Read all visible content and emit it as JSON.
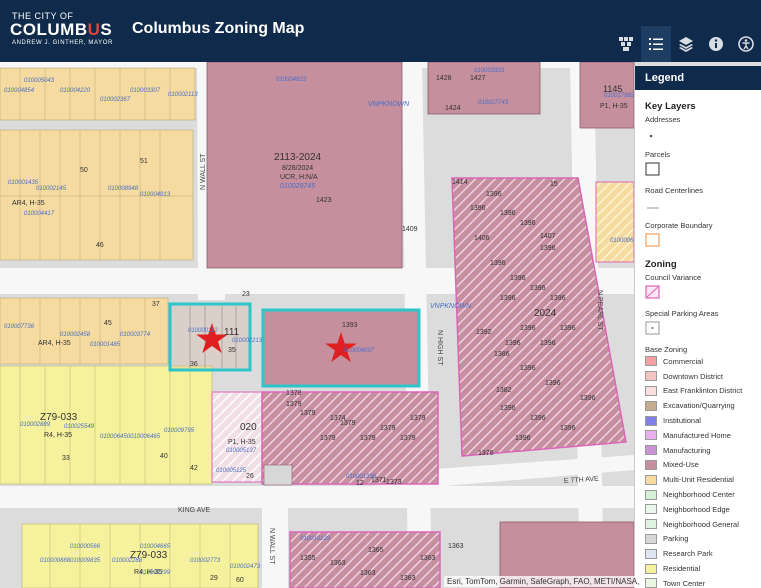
{
  "header": {
    "logo_top": "THE CITY OF",
    "logo_main_a": "COLUMB",
    "logo_main_b": "U",
    "logo_main_c": "S",
    "logo_sub": "ANDREW J. GINTHER, MAYOR",
    "title": "Columbus Zoning Map",
    "toolbar_icons": [
      "basemap-gallery-icon",
      "legend-list-icon",
      "layers-icon",
      "info-icon",
      "accessibility-icon"
    ]
  },
  "colors": {
    "header_bg": "#0f2a4a",
    "mixed_use": "#c58f9e",
    "multi_unit": "#f5dba0",
    "residential": "#f6f19c",
    "council_variance": "#d966b8",
    "selection": "#2cc6c8",
    "star": "#e02020"
  },
  "legend": {
    "title": "Legend",
    "key_layers": "Key Layers",
    "addresses": "Addresses",
    "parcels": "Parcels",
    "road_centerlines": "Road Centerlines",
    "corporate_boundary": "Corporate Boundary",
    "zoning": "Zoning",
    "council_variance": "Council Variance",
    "special_parking": "Special Parking Areas",
    "base_zoning": "Base Zoning",
    "zones": [
      {
        "label": "Commercial",
        "color": "#f3a1a1"
      },
      {
        "label": "Downtown District",
        "color": "#f6c3c3"
      },
      {
        "label": "East Franklinton District",
        "color": "#f9dede"
      },
      {
        "label": "Excavation/Quarrying",
        "color": "#c4ad8f"
      },
      {
        "label": "Institutional",
        "color": "#8080e8"
      },
      {
        "label": "Manufactured Home",
        "color": "#eab0ee"
      },
      {
        "label": "Manufacturing",
        "color": "#c993d6"
      },
      {
        "label": "Mixed-Use",
        "color": "#c58f9e"
      },
      {
        "label": "Multi-Unit Residential",
        "color": "#f5dba0"
      },
      {
        "label": "Neighborhood Center",
        "color": "#d6f0d6"
      },
      {
        "label": "Neighborhood Edge",
        "color": "#eaf6ea"
      },
      {
        "label": "Neighborhood General",
        "color": "#e1f3e1"
      },
      {
        "label": "Parking",
        "color": "#d7d7d7"
      },
      {
        "label": "Research Park",
        "color": "#dfe6ef"
      },
      {
        "label": "Residential",
        "color": "#f6f19c"
      },
      {
        "label": "Town Center",
        "color": "#e9f7e4"
      }
    ]
  },
  "map": {
    "streets": {
      "n_wall_top": "N WALL ST",
      "n_high": "N HIGH ST",
      "n_pearl": "N PEARL ST",
      "king_ave": "KING AVE",
      "e7th": "E 7TH AVE",
      "n_wall_bottom": "N WALL ST",
      "vnpknown_top": "VNPKNOWN",
      "vnpknown_mid": "VNPKNOWN"
    },
    "zone_labels": {
      "z1": "2113-2024",
      "z1b": "8/28/2024",
      "z1c": "UCR, H:N/A",
      "z1d": "010029745",
      "z2": "AR4, H-35",
      "z3": "AR4, H-35",
      "z4": "Z79-033",
      "z4b": "R4, H-35",
      "z5": "Z79-033",
      "z5b": "R4, H-35",
      "z6": "P1, H-35",
      "z7": "2024",
      "z8": "1145",
      "z8b": "P1, H-35",
      "z9": "020",
      "z10": "111",
      "z11": "35"
    },
    "addresses": [
      "1428",
      "1427",
      "1424",
      "1414",
      "1406",
      "1409",
      "1396",
      "1392",
      "1386",
      "1382",
      "1376",
      "1378",
      "1379",
      "1374",
      "1373",
      "1371",
      "1393",
      "1407",
      "1423",
      "1363",
      "1355",
      "1365",
      "15",
      "12",
      "26",
      "23",
      "37",
      "45",
      "46",
      "50",
      "51",
      "40",
      "42",
      "36",
      "33",
      "60",
      "29"
    ],
    "parcel_ids": [
      "010005043",
      "010004854",
      "010004220",
      "010002367",
      "010003307",
      "010002113",
      "010004623",
      "010002145",
      "010001435",
      "010008948",
      "010004913",
      "010004417",
      "010002458",
      "010001485",
      "010007736",
      "010003774",
      "010000112",
      "010002213",
      "010004037",
      "010005137",
      "010002889",
      "010025549",
      "010009795",
      "010006450",
      "010006465",
      "010000888",
      "010009835",
      "010002288",
      "010002299",
      "010002773",
      "010005125",
      "010010129",
      "010000566",
      "010004665",
      "010002473",
      "010001338",
      "010003333",
      "010027743",
      "010017982",
      "010000667"
    ]
  },
  "attribution": "Esri, TomTom, Garmin, SafeGraph, FAO, METI/NASA,"
}
